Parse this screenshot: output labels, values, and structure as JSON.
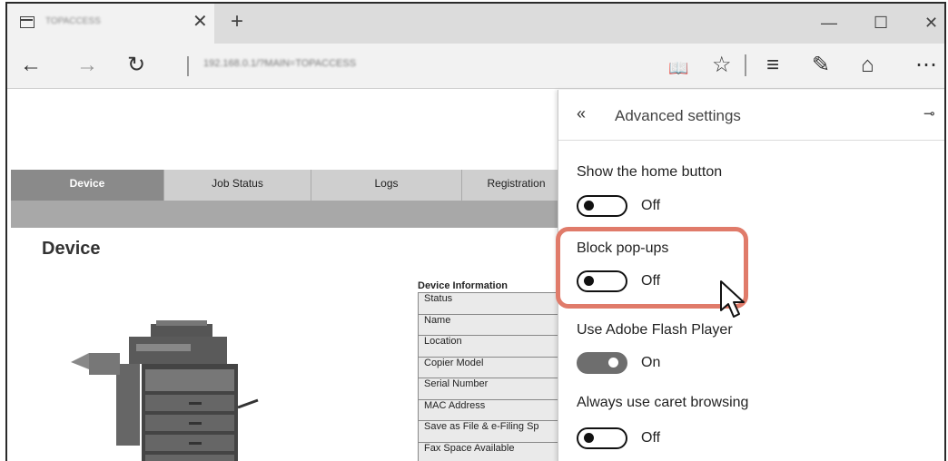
{
  "browser": {
    "tab_title": "TOPACCESS",
    "address": "192.168.0.1/?MAIN=TOPACCESS",
    "icons": {
      "tab": "page-icon",
      "close": "close-icon",
      "new_tab": "plus-icon",
      "back": "arrow-left-icon",
      "forward": "arrow-right-icon",
      "refresh": "refresh-icon",
      "reading_view": "book-icon",
      "favorite": "star-icon",
      "hub": "hub-icon",
      "note": "pen-icon",
      "share": "share-icon",
      "more": "ellipsis-icon",
      "minimize": "minimize-icon",
      "maximize": "maximize-icon",
      "window_close": "window-close-icon"
    }
  },
  "page": {
    "tabs": [
      {
        "label": "Device",
        "active": true
      },
      {
        "label": "Job Status",
        "active": false
      },
      {
        "label": "Logs",
        "active": false
      },
      {
        "label": "Registration",
        "active": false
      }
    ],
    "title": "Device",
    "info_title": "Device Information",
    "info_rows": [
      "Status",
      "Name",
      "Location",
      "Copier Model",
      "Serial Number",
      "MAC Address",
      "Save as File & e-Filing Sp",
      "Fax Space Available"
    ]
  },
  "panel": {
    "title": "Advanced settings",
    "back_icon": "double-chevron-left-icon",
    "pin_icon": "pin-icon",
    "settings": [
      {
        "label": "Show the home button",
        "state": "Off"
      },
      {
        "label": "Block pop-ups",
        "state": "Off"
      },
      {
        "label": "Use Adobe Flash Player",
        "state": "On"
      },
      {
        "label": "Always use caret browsing",
        "state": "Off"
      }
    ]
  },
  "colors": {
    "highlight": "#e07b6a",
    "tab_active": "#8a8a8a"
  }
}
